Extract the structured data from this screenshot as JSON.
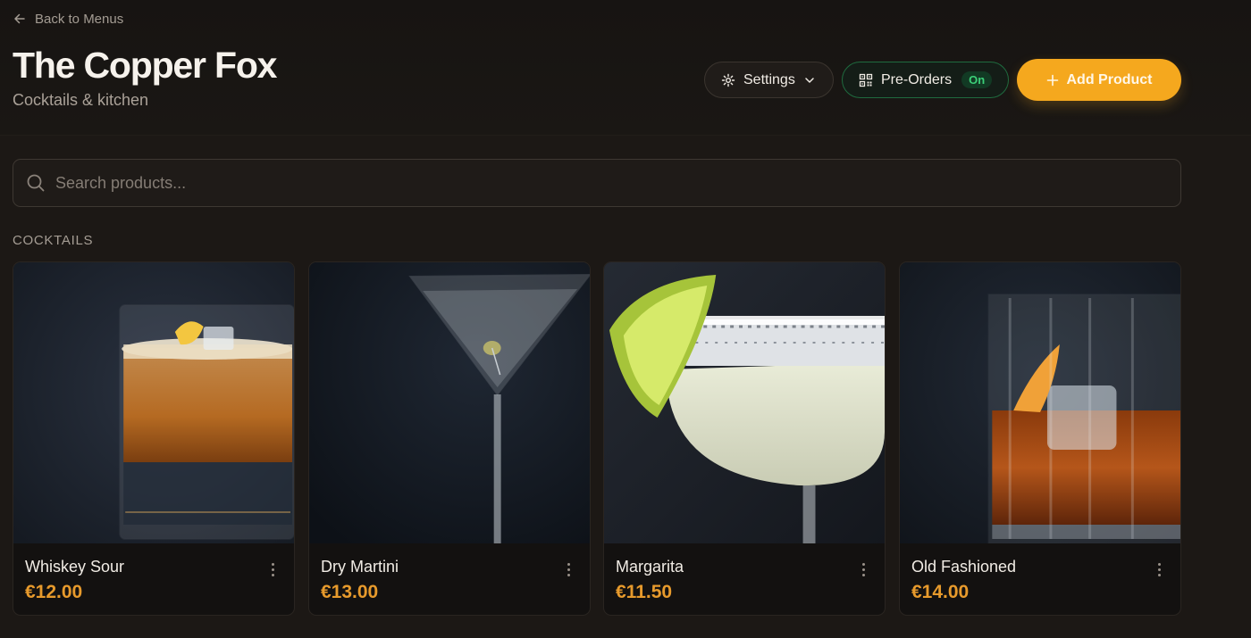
{
  "nav": {
    "back_label": "Back to Menus"
  },
  "header": {
    "title": "The Copper Fox",
    "subtitle": "Cocktails & kitchen"
  },
  "toolbar": {
    "settings_label": "Settings",
    "preorders_label": "Pre-Orders",
    "preorders_status": "On",
    "add_label": "Add Product"
  },
  "search": {
    "placeholder": "Search products..."
  },
  "section": {
    "label": "COCKTAILS"
  },
  "products": [
    {
      "name": "Whiskey Sour",
      "price": "€12.00",
      "image": "whiskey-sour-photo"
    },
    {
      "name": "Dry Martini",
      "price": "€13.00",
      "image": "dry-martini-photo"
    },
    {
      "name": "Margarita",
      "price": "€11.50",
      "image": "margarita-photo"
    },
    {
      "name": "Old Fashioned",
      "price": "€14.00",
      "image": "old-fashioned-photo"
    }
  ],
  "colors": {
    "accent": "#f5a81e",
    "price": "#e79a2c",
    "status_on": "#3ccf78",
    "background": "#1c1815"
  }
}
